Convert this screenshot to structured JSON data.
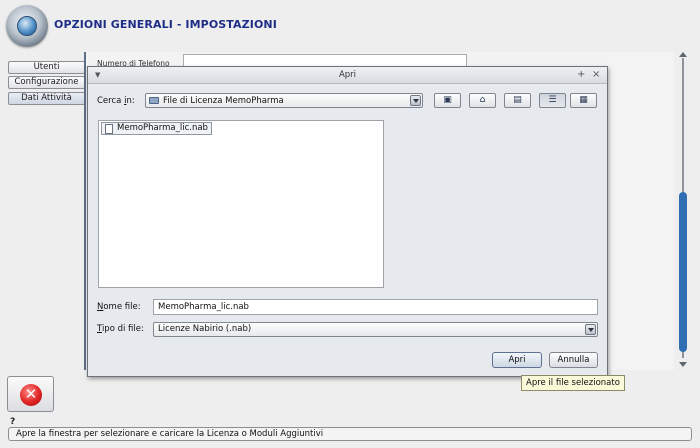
{
  "app": {
    "title": "OPZIONI GENERALI - IMPOSTAZIONI",
    "logo_icon": "gear-logo-icon"
  },
  "sidebar": {
    "items": [
      {
        "label": "Utenti"
      },
      {
        "label": "Configurazione"
      },
      {
        "label": "Dati Attività"
      }
    ]
  },
  "form": {
    "phone_label": "Numero di Telefono",
    "phone_value": ""
  },
  "dialog": {
    "title": "Apri",
    "look_in_label_pre": "Cerca ",
    "look_in_label_u": "i",
    "look_in_label_post": "n:",
    "look_in_value": "File di Licenza MemoPharma",
    "toolbar_icons": [
      "up-folder-icon",
      "home-icon",
      "new-folder-icon",
      "list-view-icon",
      "details-view-icon"
    ],
    "files": [
      {
        "name": "MemoPharma_lic.nab"
      }
    ],
    "filename_label_u": "N",
    "filename_label_post": "ome file:",
    "filename_value": "MemoPharma_lic.nab",
    "filetype_label_u": "T",
    "filetype_label_post": "ipo di file:",
    "filetype_value": "Licenze Nabirio (.nab)",
    "open_label": "Apri",
    "cancel_label": "Annulla"
  },
  "tooltip": "Apre il file selezionato",
  "help_mark": "?",
  "status_text": "Apre la finestra per selezionare e caricare la Licenza o Moduli Aggiuntivi",
  "colors": {
    "title_blue": "#1e2e86",
    "scroll_thumb": "#2e6fb4",
    "close_red": "#e02424"
  }
}
